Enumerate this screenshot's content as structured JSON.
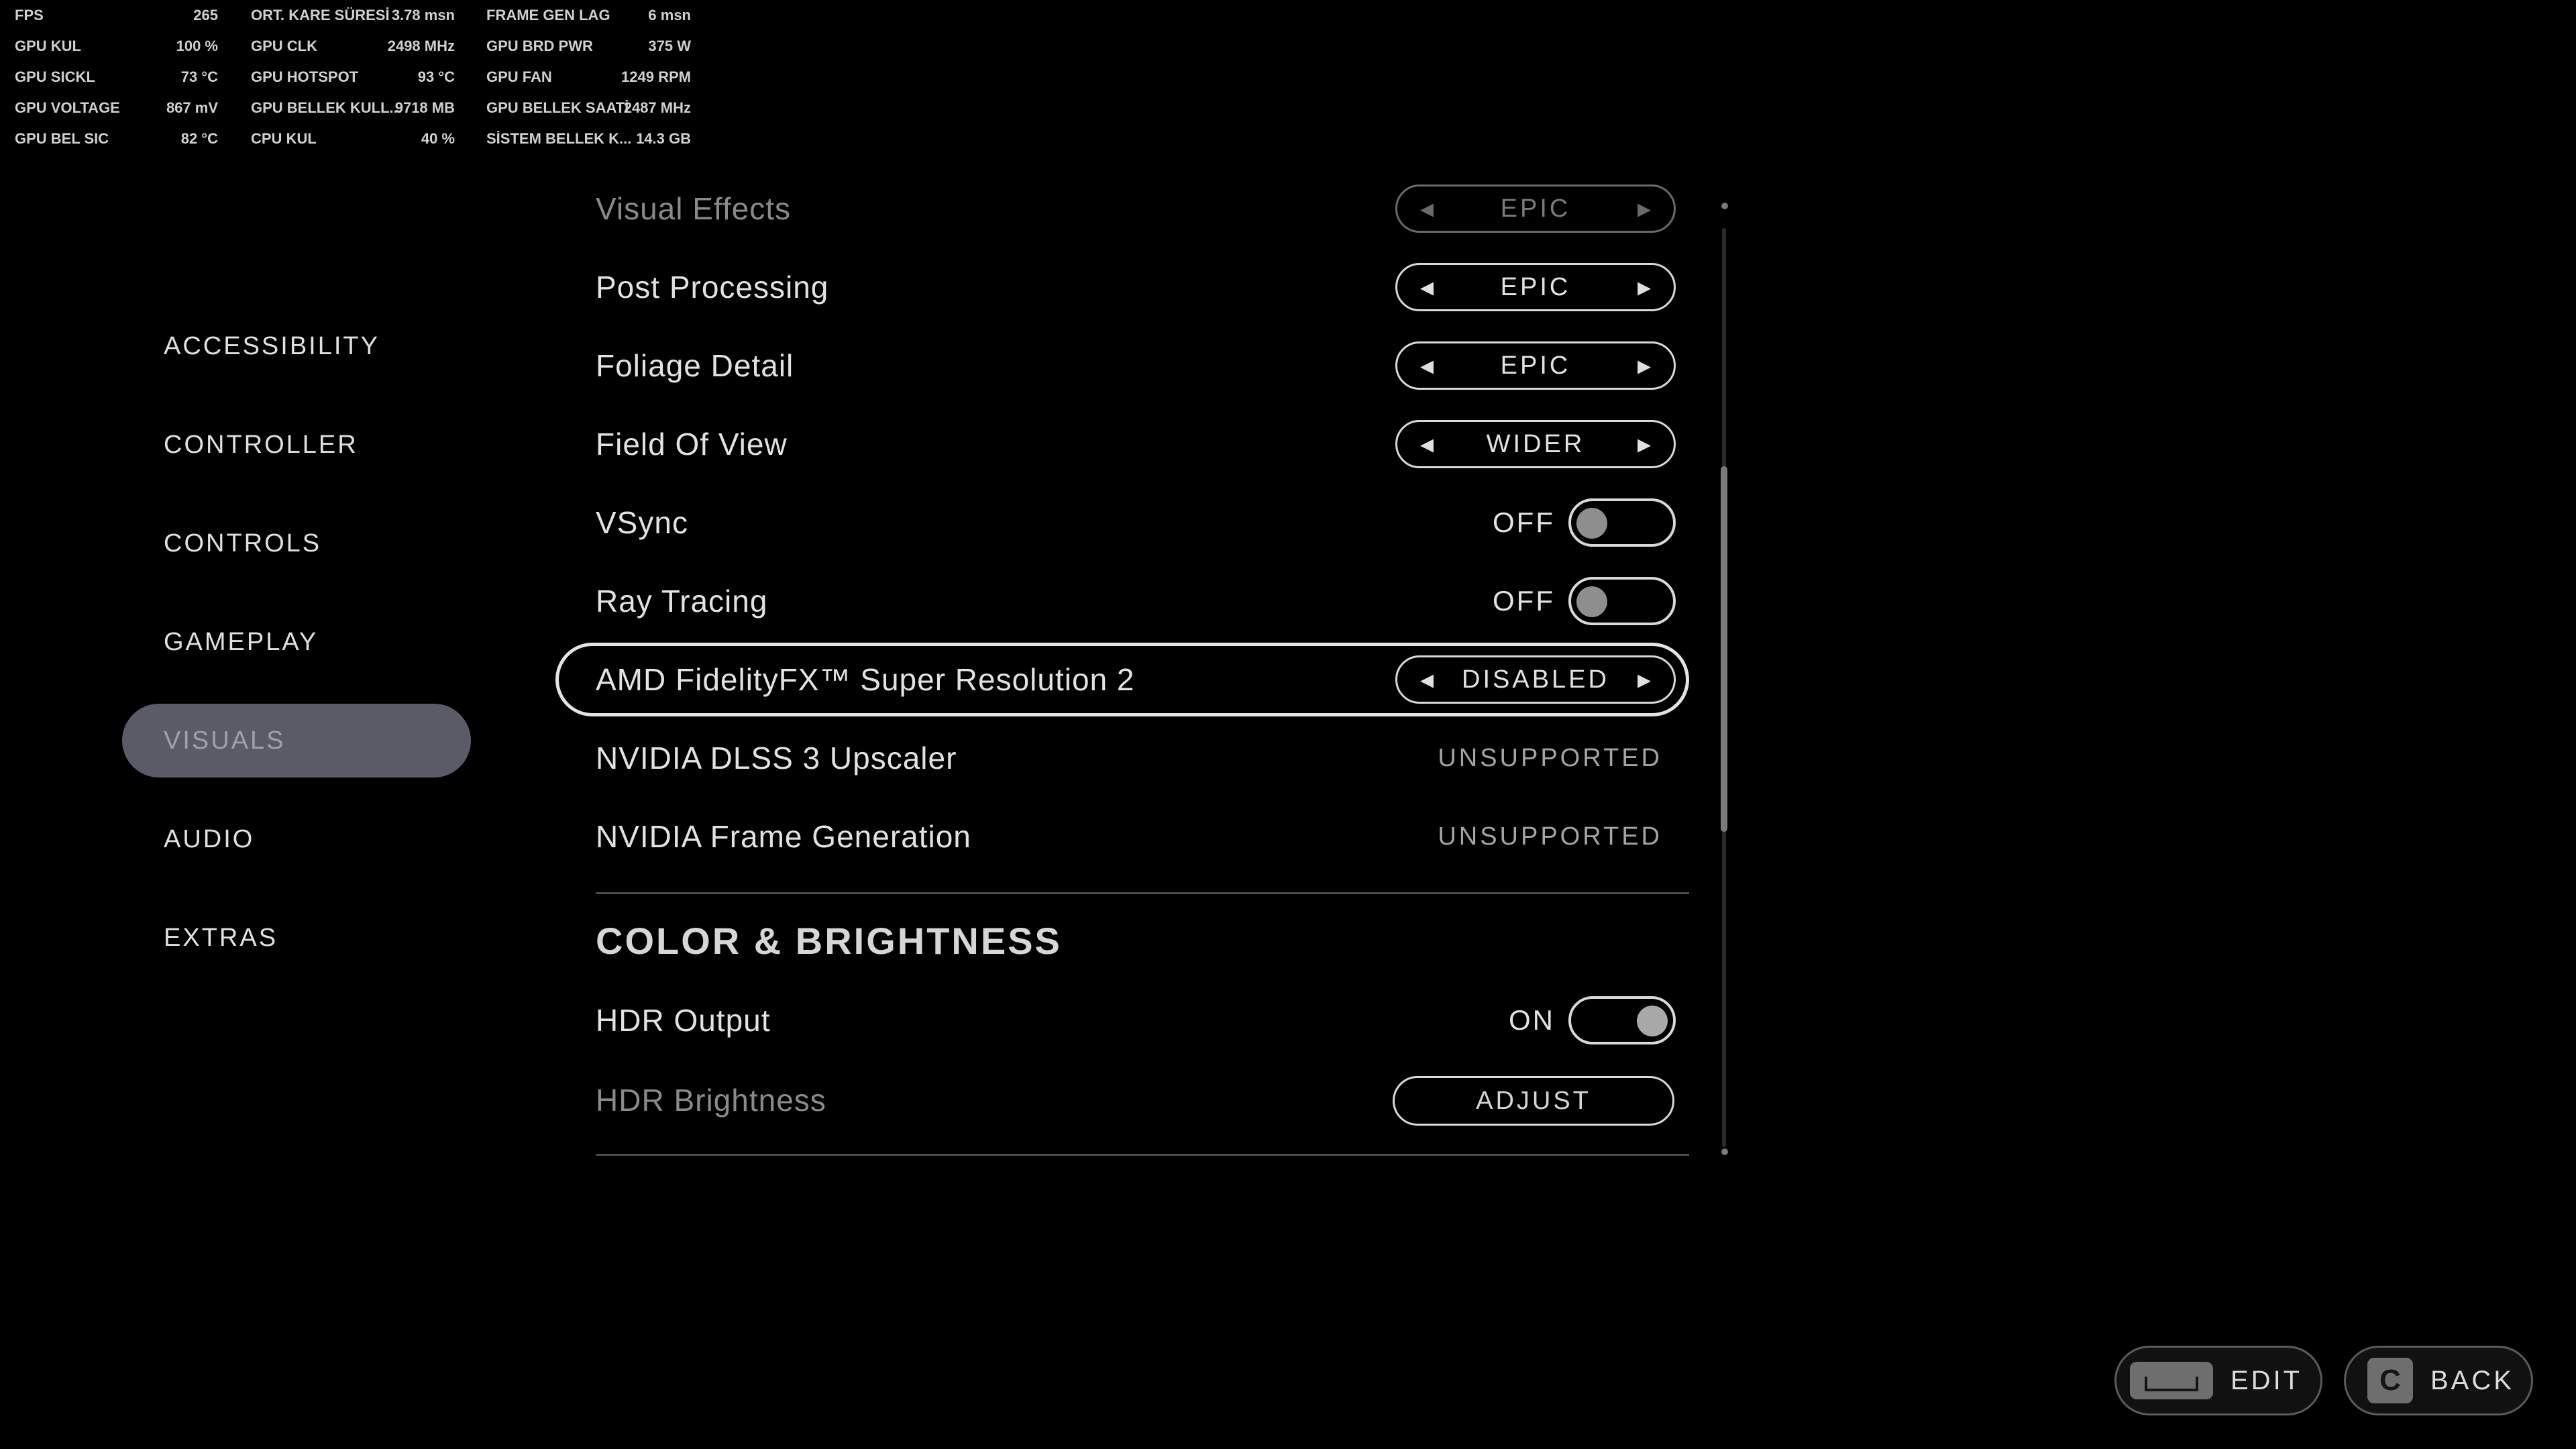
{
  "overlay": {
    "rows": [
      [
        {
          "l": "FPS",
          "v": "265"
        },
        {
          "l": "ORT. KARE SÜRESİ",
          "v": "3.78 msn"
        },
        {
          "l": "FRAME GEN LAG",
          "v": "6 msn"
        }
      ],
      [
        {
          "l": "GPU KUL",
          "v": "100 %"
        },
        {
          "l": "GPU CLK",
          "v": "2498 MHz"
        },
        {
          "l": "GPU BRD PWR",
          "v": "375 W"
        }
      ],
      [
        {
          "l": "GPU SICKL",
          "v": "73 °C"
        },
        {
          "l": "GPU HOTSPOT",
          "v": "93 °C"
        },
        {
          "l": "GPU FAN",
          "v": "1249 RPM"
        }
      ],
      [
        {
          "l": "GPU VOLTAGE",
          "v": "867 mV"
        },
        {
          "l": "GPU BELLEK KULL...",
          "v": "9718 MB"
        },
        {
          "l": "GPU BELLEK SAATİ",
          "v": "2487 MHz"
        }
      ],
      [
        {
          "l": "GPU BEL SIC",
          "v": "82 °C"
        },
        {
          "l": "CPU KUL",
          "v": "40 %"
        },
        {
          "l": "SİSTEM BELLEK K...",
          "v": "14.3 GB"
        }
      ]
    ]
  },
  "nav": {
    "items": [
      {
        "label": "ACCESSIBILITY"
      },
      {
        "label": "CONTROLLER"
      },
      {
        "label": "CONTROLS"
      },
      {
        "label": "GAMEPLAY"
      },
      {
        "label": "VISUALS"
      },
      {
        "label": "AUDIO"
      },
      {
        "label": "EXTRAS"
      }
    ],
    "active": "VISUALS"
  },
  "settings": {
    "visual_effects": {
      "label": "Visual Effects",
      "value": "EPIC"
    },
    "post_processing": {
      "label": "Post Processing",
      "value": "EPIC"
    },
    "foliage_detail": {
      "label": "Foliage Detail",
      "value": "EPIC"
    },
    "field_of_view": {
      "label": "Field Of View",
      "value": "WIDER"
    },
    "vsync": {
      "label": "VSync",
      "state": "OFF"
    },
    "ray_tracing": {
      "label": "Ray Tracing",
      "state": "OFF"
    },
    "fsr2": {
      "label": "AMD FidelityFX™ Super Resolution 2",
      "value": "DISABLED"
    },
    "dlss3": {
      "label": "NVIDIA DLSS 3 Upscaler",
      "value": "UNSUPPORTED"
    },
    "frame_gen": {
      "label": "NVIDIA Frame Generation",
      "value": "UNSUPPORTED"
    }
  },
  "color_brightness": {
    "heading": "COLOR & BRIGHTNESS",
    "hdr_output": {
      "label": "HDR Output",
      "state": "ON"
    },
    "hdr_brightness": {
      "label": "HDR Brightness",
      "button": "ADJUST"
    }
  },
  "icons": {
    "arrow_left": "◂",
    "arrow_right": "▸",
    "back_key": "C"
  },
  "footer": {
    "edit_label": "EDIT",
    "back_label": "BACK"
  },
  "colors": {
    "background": "#000000",
    "active_nav": "#5b5b67",
    "text": "#e2e2e2"
  }
}
